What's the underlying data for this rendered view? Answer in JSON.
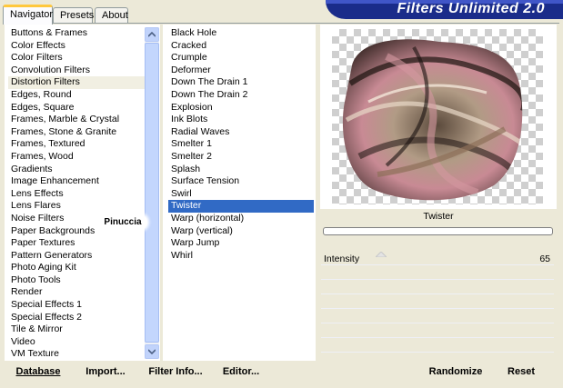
{
  "tabs": [
    {
      "label": "Navigator",
      "active": true
    },
    {
      "label": "Presets",
      "active": false
    },
    {
      "label": "About",
      "active": false
    }
  ],
  "banner": {
    "title": "Filters Unlimited 2.0"
  },
  "categories": {
    "items": [
      "Buttons & Frames",
      "Color Effects",
      "Color Filters",
      "Convolution Filters",
      "Distortion Filters",
      "Edges, Round",
      "Edges, Square",
      "Frames, Marble & Crystal",
      "Frames, Stone & Granite",
      "Frames, Textured",
      "Frames, Wood",
      "Gradients",
      "Image Enhancement",
      "Lens Effects",
      "Lens Flares",
      "Noise Filters",
      "Paper Backgrounds",
      "Paper Textures",
      "Pattern Generators",
      "Photo Aging Kit",
      "Photo Tools",
      "Render",
      "Special Effects 1",
      "Special Effects 2",
      "Tile & Mirror",
      "Video",
      "VM Texture"
    ],
    "selected": "Distortion Filters"
  },
  "watermark": "Pinuccia",
  "filters": {
    "items": [
      "Black Hole",
      "Cracked",
      "Crumple",
      "Deformer",
      "Down The Drain 1",
      "Down The Drain 2",
      "Explosion",
      "Ink Blots",
      "Radial Waves",
      "Smelter 1",
      "Smelter 2",
      "Splash",
      "Surface Tension",
      "Swirl",
      "Twister",
      "Warp (horizontal)",
      "Warp (vertical)",
      "Warp Jump",
      "Whirl"
    ],
    "selected": "Twister"
  },
  "preview": {
    "filter_name": "Twister",
    "progress": 0
  },
  "params": [
    {
      "label": "Intensity",
      "value": "65"
    }
  ],
  "buttons_left": {
    "database": "Database",
    "import": "Import...",
    "filter_info": "Filter Info...",
    "editor": "Editor..."
  },
  "buttons_right": {
    "randomize": "Randomize",
    "reset": "Reset"
  },
  "colors": {
    "selection": "#316ac5",
    "banner": "#1a2c8a",
    "tab_highlight": "#ffc83c"
  }
}
